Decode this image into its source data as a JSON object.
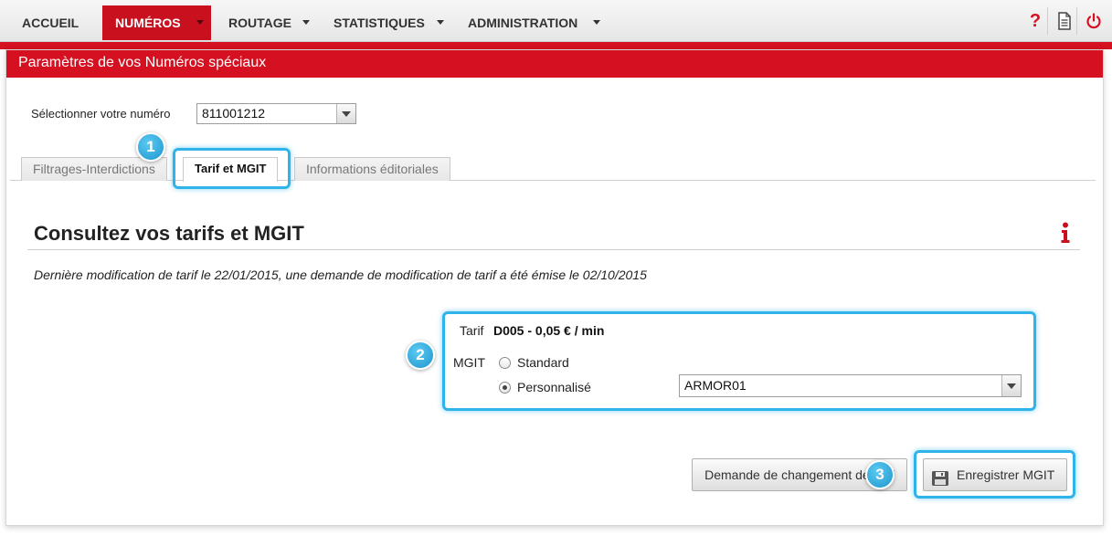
{
  "nav": {
    "items": [
      {
        "label": "ACCUEIL"
      },
      {
        "label": "NUMÉROS"
      },
      {
        "label": "ROUTAGE"
      },
      {
        "label": "STATISTIQUES"
      },
      {
        "label": "ADMINISTRATION"
      }
    ],
    "help_glyph": "?",
    "icons": [
      "help-icon",
      "document-icon",
      "power-icon"
    ]
  },
  "panel": {
    "title": "Paramètres de vos Numéros spéciaux",
    "select_label": "Sélectionner votre numéro",
    "selected_number": "811001212",
    "tabs": [
      {
        "label": "Filtrages-Interdictions"
      },
      {
        "label": "Tarif et MGIT"
      },
      {
        "label": "Informations éditoriales"
      }
    ],
    "active_tab": "Tarif et MGIT",
    "section_title": "Consultez vos tarifs et MGIT",
    "notice": "Dernière modification de tarif le 22/01/2015, une demande de modification de tarif a été émise le 02/10/2015",
    "tarif_label": "Tarif",
    "tarif_value": "D005 - 0,05 € / min",
    "mgit_label": "MGIT",
    "mgit_options": [
      {
        "label": "Standard",
        "checked": false
      },
      {
        "label": "Personnalisé",
        "checked": true
      }
    ],
    "mgit_custom_value": "ARMOR01",
    "buttons": {
      "change_tarif": "Demande de changement de tarif",
      "save_mgit": "Enregistrer MGIT"
    }
  },
  "callouts": [
    "1",
    "2",
    "3"
  ],
  "colors": {
    "brand_red": "#d51020",
    "highlight_blue": "#2fb3e8"
  }
}
